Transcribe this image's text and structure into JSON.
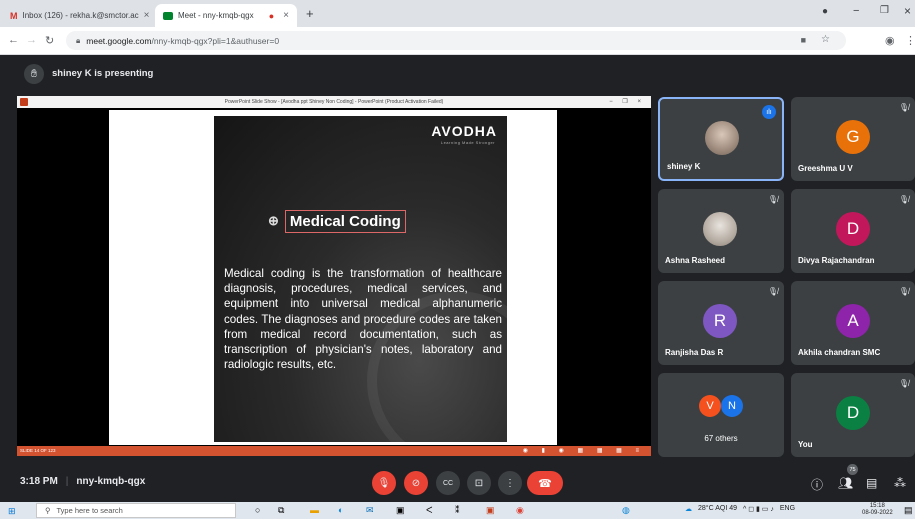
{
  "browser": {
    "tabs": [
      {
        "label": "Inbox (126) - rekha.k@smctor.ac",
        "icon": "gmail-icon",
        "active": false
      },
      {
        "label": "Meet - nny-kmqb-qgx",
        "icon": "meet-icon",
        "active": true
      }
    ],
    "new_tab": "+",
    "url_host": "meet.google.com",
    "url_path": "/nny-kmqb-qgx?pli=1&authuser=0"
  },
  "presenting_banner": "shiney K is presenting",
  "ppt_window_title": "PowerPoint Slide Show - [Avodha ppt Shiney Non Coding] - PowerPoint (Product Activation Failed)",
  "slide": {
    "brand": "AVODHA",
    "tagline": "Learning Made Stronger",
    "title": "Medical Coding",
    "body": "Medical coding is the transformation of healthcare diagnosis, procedures, medical services, and equipment into universal medical alphanumeric codes. The diagnoses and procedure codes are taken from medical record documentation, such as transcription of physician's notes, laboratory and radiologic results, etc.",
    "counter": "SLIDE 14 OF 123"
  },
  "participants": [
    {
      "name": "shiney K",
      "type": "photo",
      "speaking": true
    },
    {
      "name": "Greeshma U V",
      "initial": "G",
      "color": "#e8710a"
    },
    {
      "name": "Ashna Rasheed",
      "type": "photo"
    },
    {
      "name": "Divya Rajachandran",
      "initial": "D",
      "color": "#c2185b"
    },
    {
      "name": "Ranjisha Das R",
      "initial": "R",
      "color": "#7e57c2"
    },
    {
      "name": "Akhila chandran SMC",
      "initial": "A",
      "color": "#8e24aa"
    },
    {
      "name": "67 others",
      "initials": [
        "V",
        "N"
      ],
      "colors": [
        "#f4511e",
        "#1a73e8"
      ]
    },
    {
      "name": "You",
      "initial": "D",
      "color": "#0b8043"
    }
  ],
  "meeting": {
    "time": "3:18 PM",
    "code": "nny-kmqb-qgx",
    "participant_count": "75"
  },
  "taskbar": {
    "search_placeholder": "Type here to search",
    "weather": "28°C  AQI 49",
    "lang": "ENG",
    "clock_time": "15:18",
    "clock_date": "08-09-2022"
  }
}
